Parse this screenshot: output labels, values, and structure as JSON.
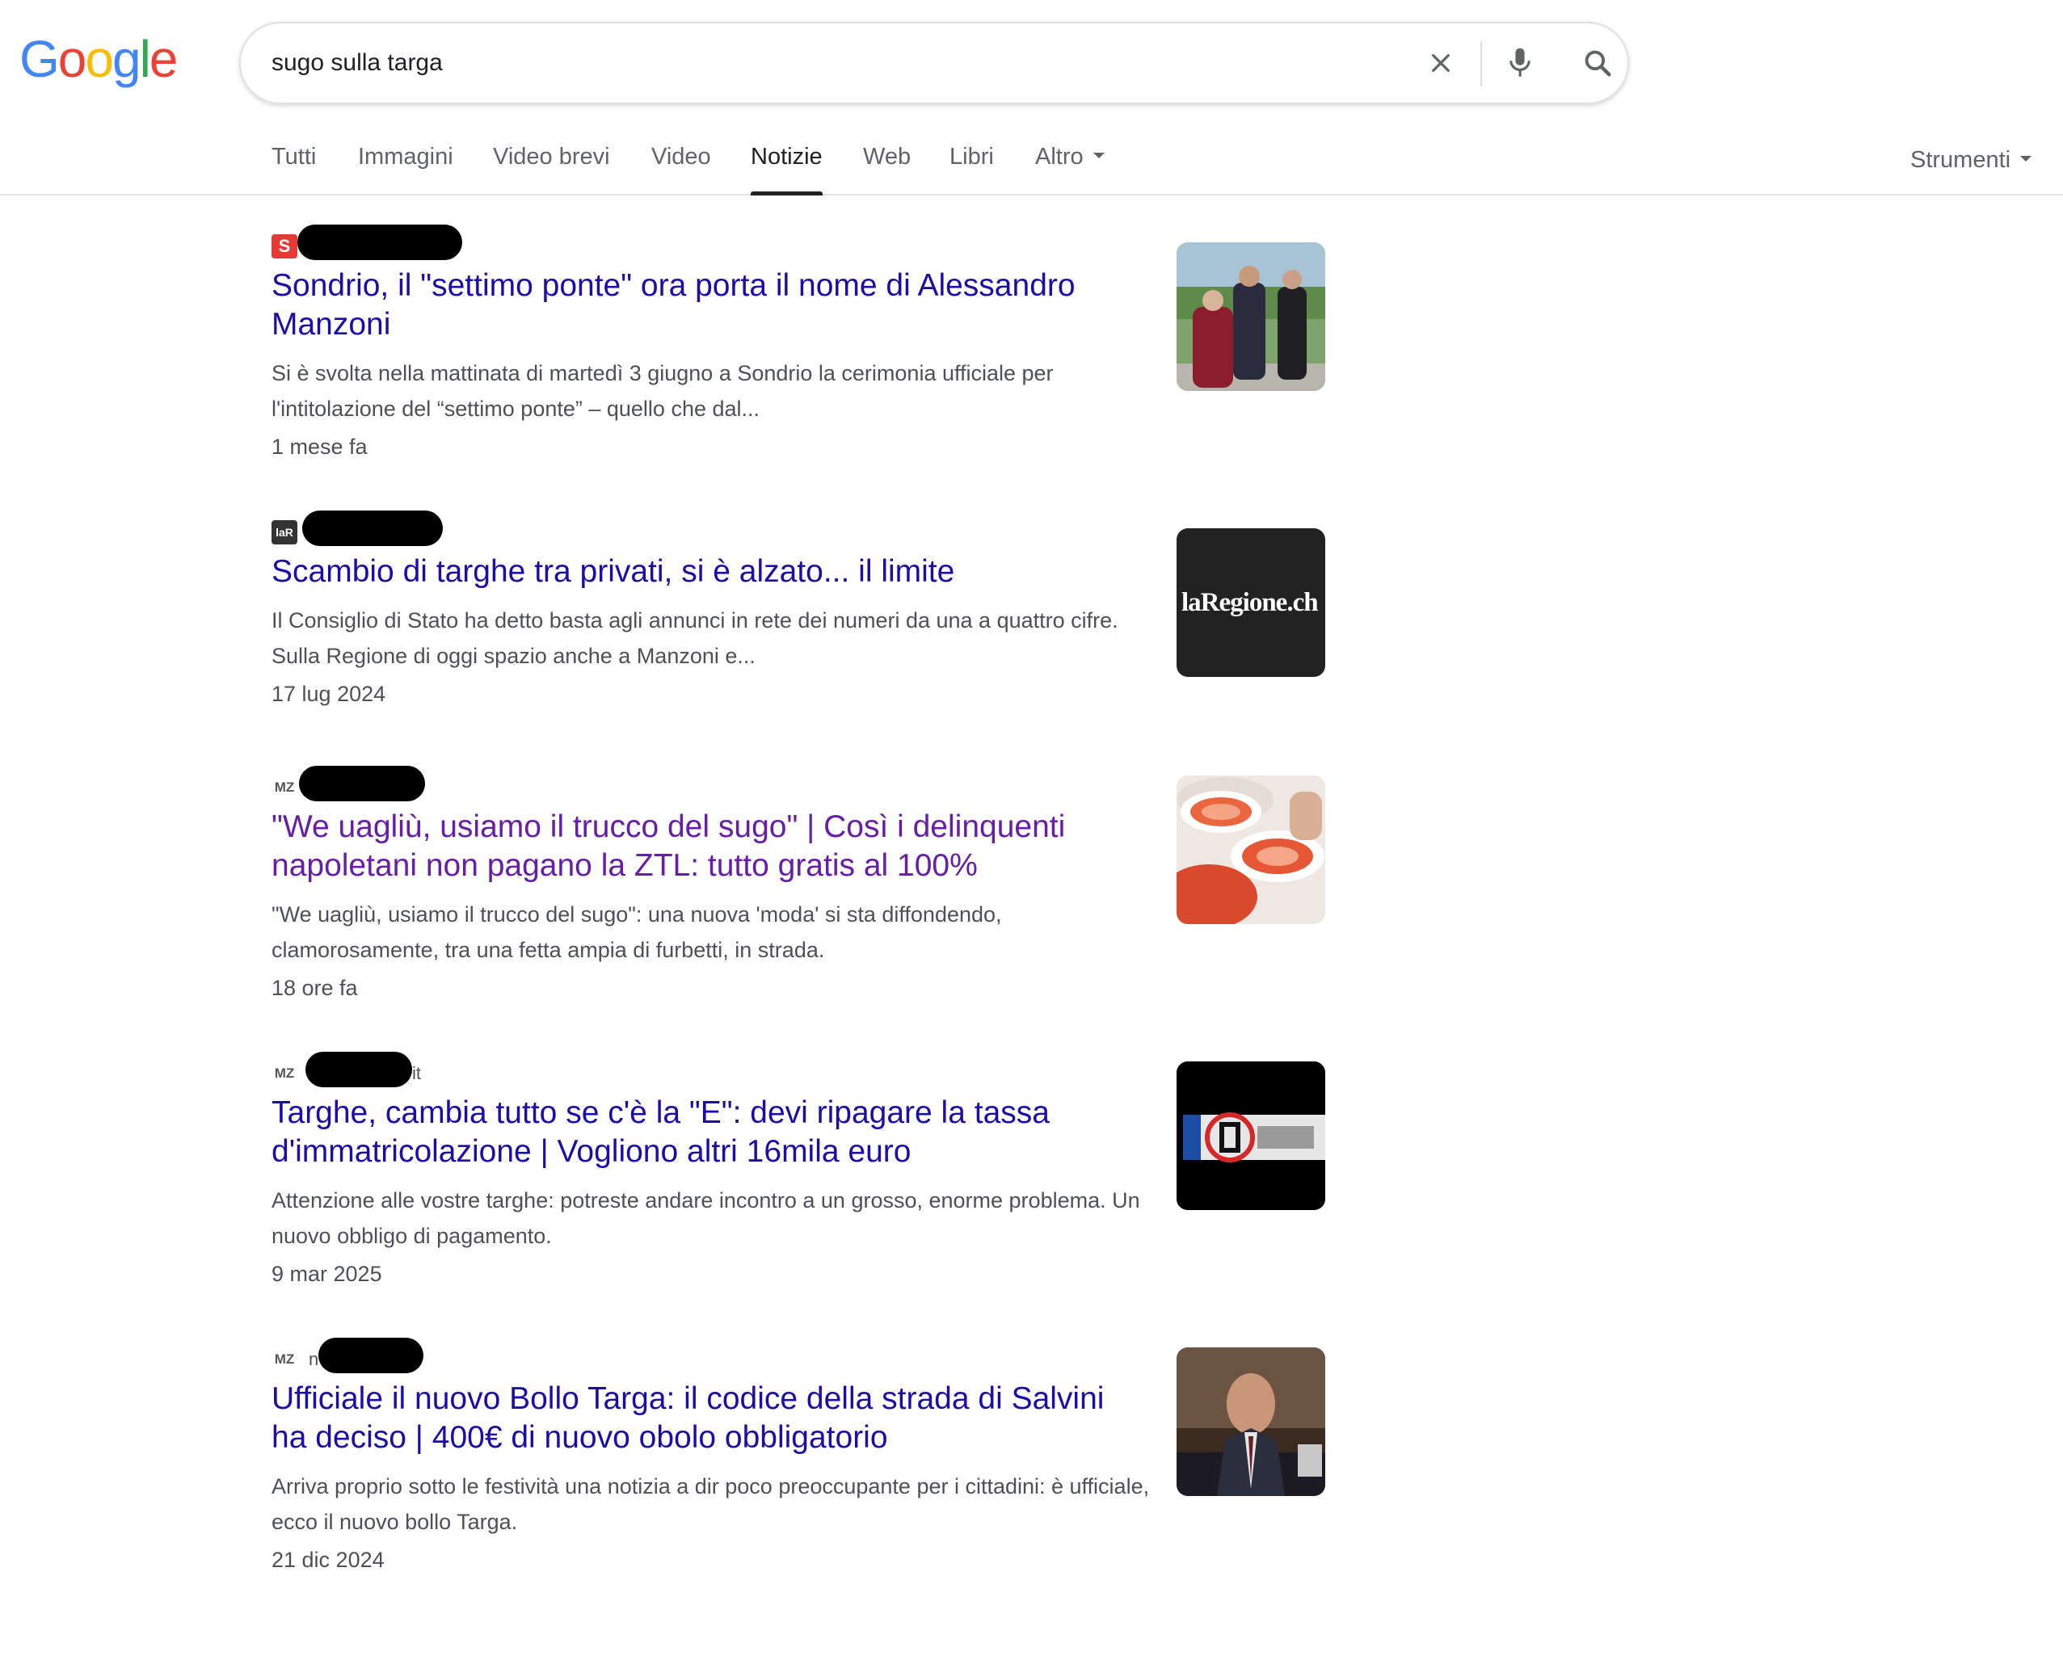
{
  "search": {
    "query": "sugo sulla targa"
  },
  "tabs": [
    "Tutti",
    "Immagini",
    "Video brevi",
    "Video",
    "Notizie",
    "Web",
    "Libri",
    "Altro"
  ],
  "active_tab": "Notizie",
  "tools_label": "Strumenti",
  "colors": {
    "link": "#1a0dab",
    "visited": "#681da8",
    "snippet": "#4d5156"
  },
  "results": [
    {
      "title": "Sondrio, il \"settimo ponte\" ora porta il nome di Alessandro Manzoni",
      "snippet": "Si è svolta nella mattinata di martedì 3 giugno a Sondrio la cerimonia ufficiale per l'intitolazione del “settimo ponte” – quello che dal...",
      "date": "1 mese fa",
      "favicon": "S",
      "source_tail": "",
      "visited": false
    },
    {
      "title": "Scambio di targhe tra privati, si è alzato... il limite",
      "snippet": "Il Consiglio di Stato ha detto basta agli annunci in rete dei numeri da una a quattro cifre. Sulla Regione di oggi spazio anche a Manzoni e...",
      "date": "17 lug 2024",
      "favicon": "laR",
      "thumb_text": "laRegione.ch",
      "source_tail": "",
      "visited": false
    },
    {
      "title": "\"We uagliù, usiamo il trucco del sugo\" | Così i delinquenti napoletani non pagano la ZTL: tutto gratis al 100%",
      "snippet": "\"We uagliù, usiamo il trucco del sugo\": una nuova 'moda' si sta diffondendo, clamorosamente, tra una fetta ampia di furbetti, in strada.",
      "date": "18 ore fa",
      "favicon": "MZ",
      "source_tail": "",
      "visited": true
    },
    {
      "title": "Targhe, cambia tutto se c'è la \"E\": devi ripagare la tassa d'immatricolazione | Vogliono altri 16mila euro",
      "snippet": "Attenzione alle vostre targhe: potreste andare incontro a un grosso, enorme problema. Un nuovo obbligo di pagamento.",
      "date": "9 mar 2025",
      "favicon": "MZ",
      "source_tail": "it",
      "visited": false
    },
    {
      "title": "Ufficiale il nuovo Bollo Targa: il codice della strada di Salvini ha deciso | 400€ di nuovo obolo obbligatorio",
      "snippet": "Arriva proprio sotto le festività una notizia a dir poco preoccupante per i cittadini: è ufficiale, ecco il nuovo bollo Targa.",
      "date": "21 dic 2024",
      "favicon": "MZ",
      "source_tail": "n",
      "visited": false
    }
  ]
}
